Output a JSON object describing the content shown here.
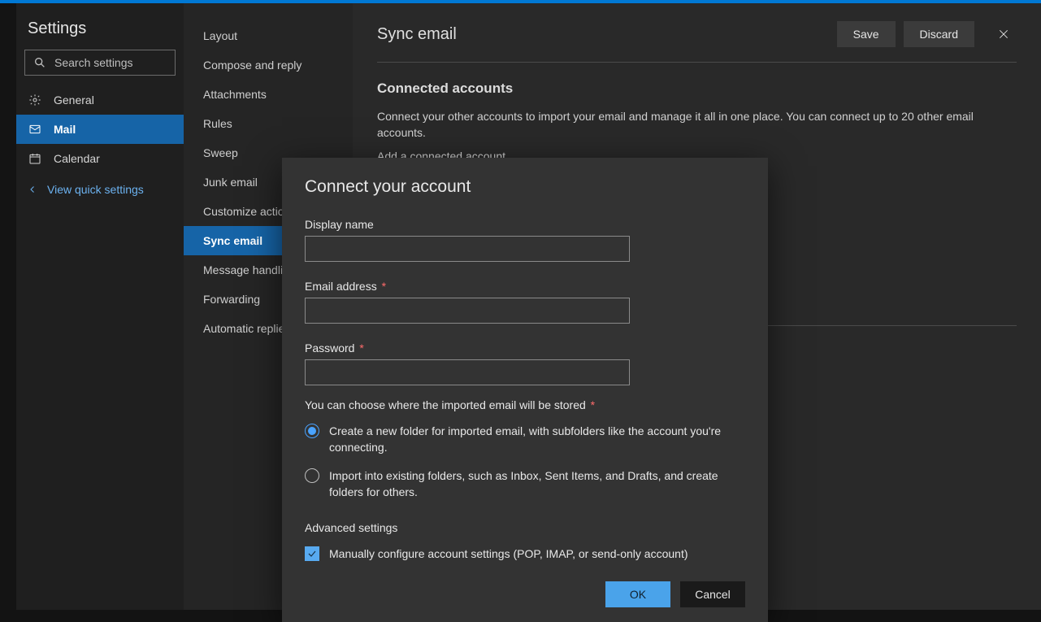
{
  "sidebar": {
    "title": "Settings",
    "search_placeholder": "Search settings",
    "nav": [
      {
        "label": "General"
      },
      {
        "label": "Mail"
      },
      {
        "label": "Calendar"
      }
    ],
    "quick_link": "View quick settings"
  },
  "subnav": {
    "items": [
      "Layout",
      "Compose and reply",
      "Attachments",
      "Rules",
      "Sweep",
      "Junk email",
      "Customize actions",
      "Sync email",
      "Message handling",
      "Forwarding",
      "Automatic replies"
    ]
  },
  "main": {
    "title": "Sync email",
    "save_label": "Save",
    "discard_label": "Discard",
    "section_title": "Connected accounts",
    "section_desc": "Connect your other accounts to import your email and manage it all in one place. You can connect up to 20 other email accounts.",
    "add_link": "Add a connected account"
  },
  "dialog": {
    "title": "Connect your account",
    "display_name_label": "Display name",
    "display_name_value": "",
    "email_label": "Email address",
    "email_value": "",
    "password_label": "Password",
    "password_value": "",
    "storage_hint": "You can choose where the imported email will be stored",
    "radio1": "Create a new folder for imported email, with subfolders like the account you're connecting.",
    "radio2": "Import into existing folders, such as Inbox, Sent Items, and Drafts, and create folders for others.",
    "advanced_title": "Advanced settings",
    "manual_label": "Manually configure account settings (POP, IMAP, or send-only account)",
    "ok_label": "OK",
    "cancel_label": "Cancel"
  }
}
